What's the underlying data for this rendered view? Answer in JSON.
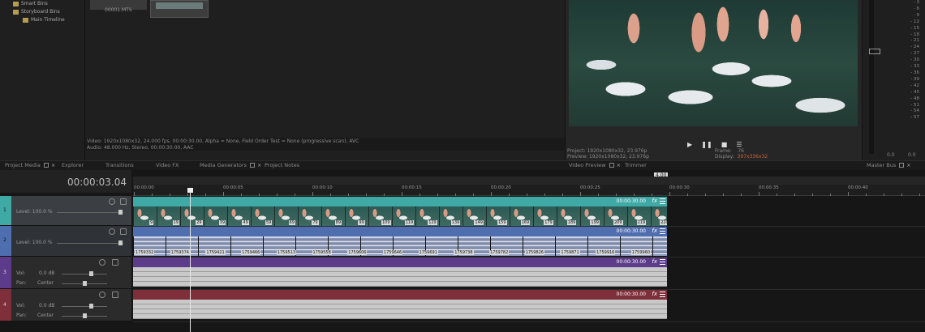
{
  "explorer": {
    "tree": [
      "Smart Bins",
      "Storyboard Bins",
      "Main Timeline"
    ]
  },
  "media": {
    "thumb1_label": "00001.MTS",
    "info_video": "Video: 1920x1080x32, 24.000 fps, 00:00:30.00, Alpha = None, Field Order Test = None (progressive scan), AVC",
    "info_audio": "Audio: 48.000 Hz, Stereo, 00:00:30.00, AAC"
  },
  "preview": {
    "project_label": "Project:",
    "project_value": "1920x1080x32, 23.976p",
    "preview_label": "Preview:",
    "preview_value": "1920x1080x32, 23.976p",
    "frame_label": "Frame:",
    "frame_value": "76",
    "display_label": "Display:",
    "display_value": "397x336x32"
  },
  "master": {
    "scale": [
      "3",
      "6",
      "9",
      "12",
      "15",
      "18",
      "21",
      "24",
      "27",
      "30",
      "33",
      "36",
      "39",
      "42",
      "45",
      "48",
      "51",
      "54",
      "57"
    ],
    "bottom_left": "0.0",
    "bottom_right": "0.0"
  },
  "tabs": {
    "project_media": "Project Media",
    "explorer": "Explorer",
    "transitions": "Transitions",
    "video_fx": "Video FX",
    "media_generators": "Media Generators",
    "project_notes": "Project Notes",
    "video_preview": "Video Preview",
    "trimmer": "Trimmer",
    "master_bus": "Master Bus"
  },
  "timeline": {
    "timecode": "00:00:03.04",
    "rate_badge": "4.00",
    "ruler": [
      "00:00:00",
      "00:00:05",
      "00:00:10",
      "00:00:15",
      "00:00:20",
      "00:00:25",
      "00:00:30",
      "00:00:35",
      "00:00:40"
    ],
    "tracks": [
      {
        "num": "1",
        "level": "Level: 100.0 %",
        "clip_tc": "00:00:30.00",
        "clip_color": "#3fa9a6"
      },
      {
        "num": "2",
        "level": "Level: 100.0 %",
        "clip_tc": "00:00:30.00",
        "clip_color": "#4f6eb0"
      },
      {
        "num": "3",
        "vol_label": "Vol:",
        "vol": "0.0 dB",
        "pan_label": "Pan:",
        "pan": "Center",
        "clip_tc": "00:00:30.00",
        "clip_color": "#5c3b8a"
      },
      {
        "num": "4",
        "vol_label": "Vol:",
        "vol": "0.0 dB",
        "pan_label": "Pan:",
        "pan": "Center",
        "clip_tc": "00:00:30.00",
        "clip_color": "#7e2f3a"
      }
    ],
    "v2_frame_tags": [
      "1759332",
      "1759374",
      "1759421",
      "1759466",
      "1759513",
      "1759558",
      "1759606",
      "1759646",
      "1759691",
      "1759738",
      "1759782",
      "1759826",
      "1759871",
      "1759916",
      "1759960"
    ],
    "v1_frame_tags": [
      "9",
      "19",
      "29",
      "39",
      "49",
      "59",
      "69",
      "79",
      "89",
      "99",
      "109",
      "119",
      "129",
      "139",
      "149",
      "159",
      "169",
      "179",
      "189",
      "199",
      "209",
      "219",
      "229"
    ]
  }
}
